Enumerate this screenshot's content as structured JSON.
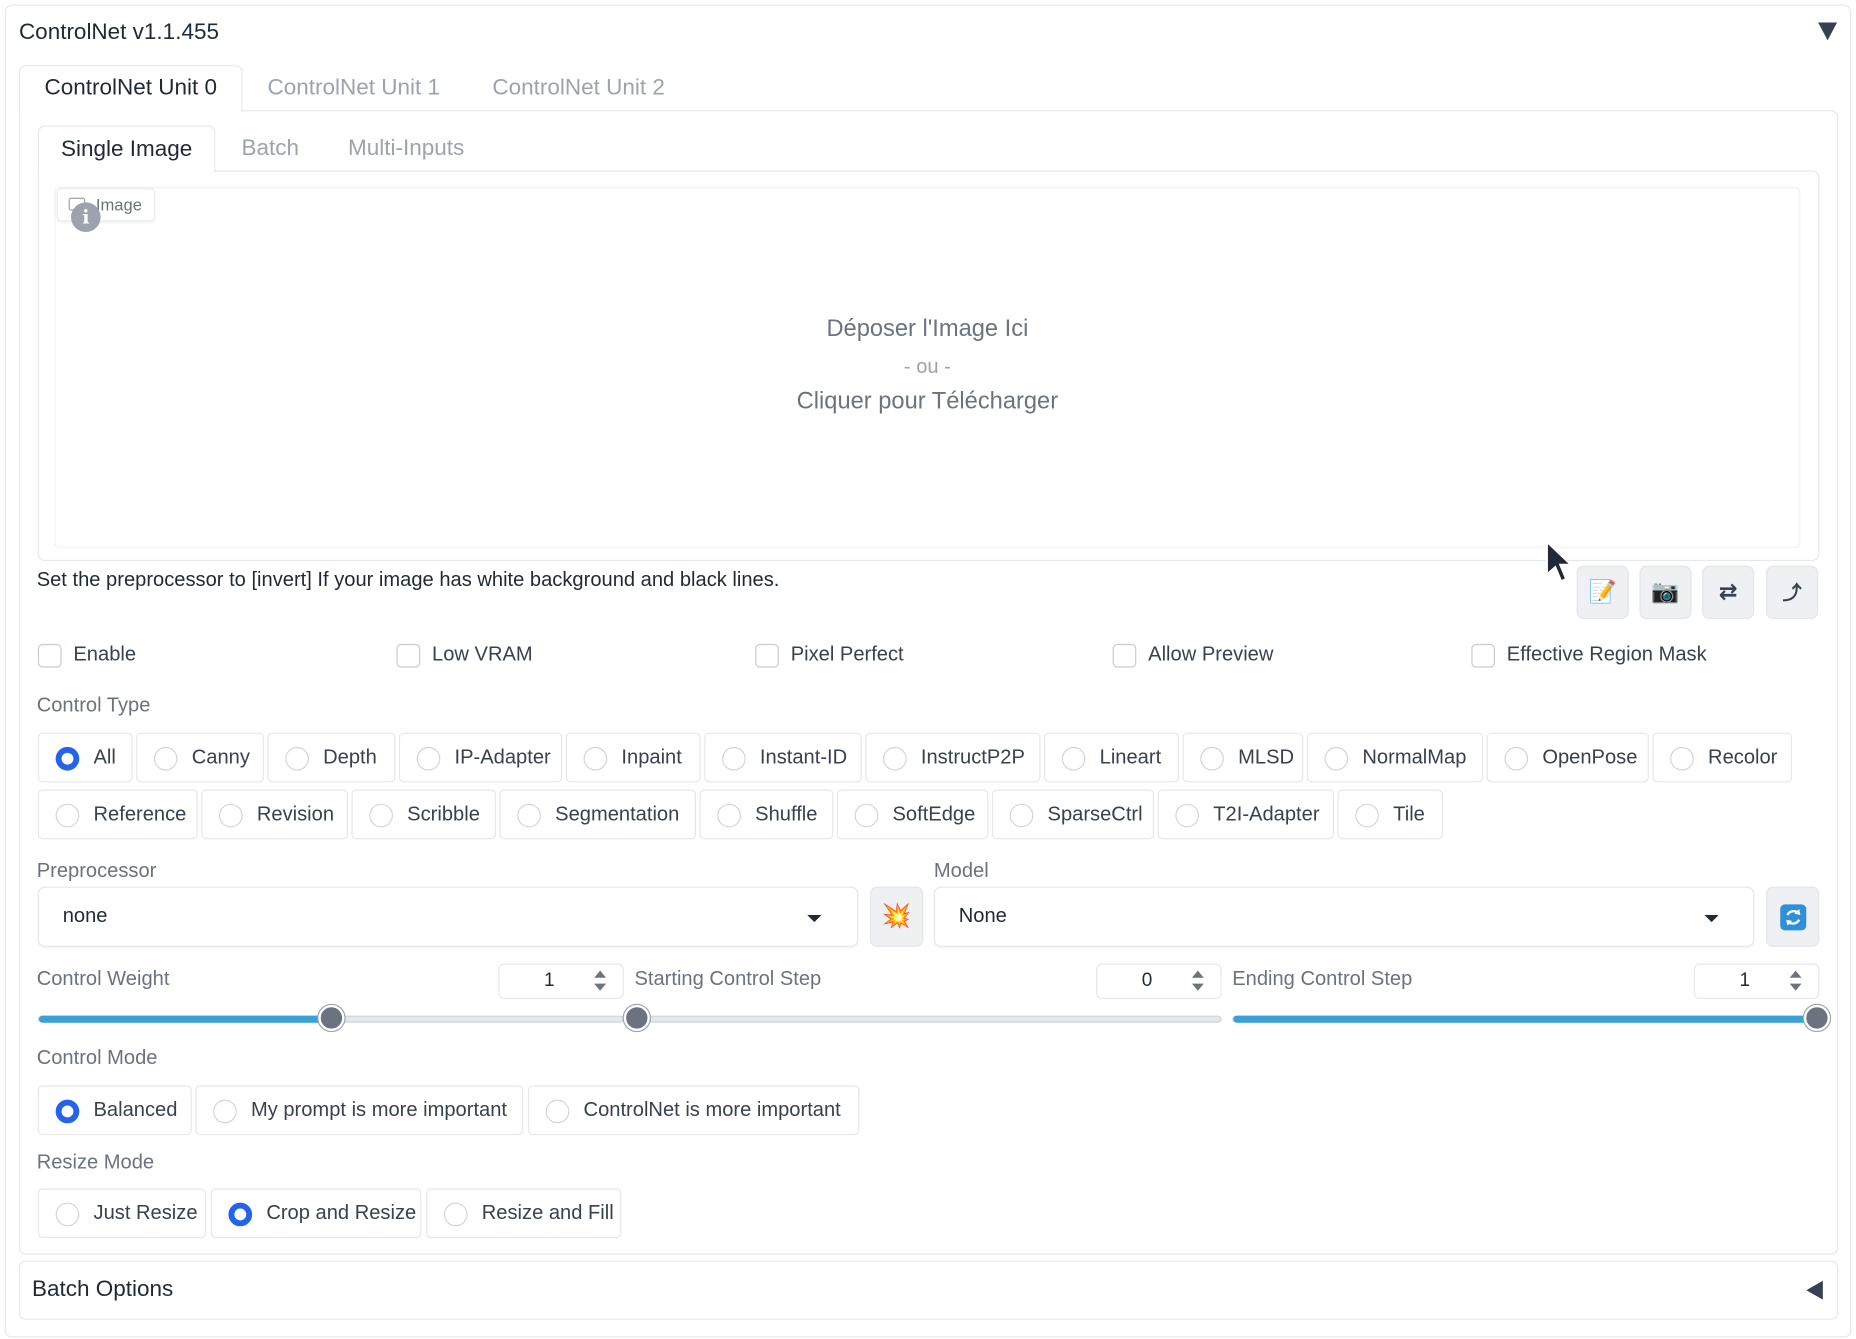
{
  "header": {
    "title": "ControlNet v1.1.455"
  },
  "unit_tabs": [
    "ControlNet Unit 0",
    "ControlNet Unit 1",
    "ControlNet Unit 2"
  ],
  "image_tabs": [
    "Single Image",
    "Batch",
    "Multi-Inputs"
  ],
  "upload": {
    "chip_label": "Image",
    "drop_text": "Déposer l'Image Ici",
    "or_text": "- ou -",
    "click_text": "Cliquer pour Télécharger"
  },
  "hint": "Set the preprocessor to [invert] If your image has white background and black lines.",
  "toolbar": {
    "icons": [
      "pencil-icon",
      "camera-icon",
      "swap-icon",
      "send-icon"
    ]
  },
  "checkboxes": [
    {
      "label": "Enable",
      "checked": false
    },
    {
      "label": "Low VRAM",
      "checked": false
    },
    {
      "label": "Pixel Perfect",
      "checked": false
    },
    {
      "label": "Allow Preview",
      "checked": false
    },
    {
      "label": "Effective Region Mask",
      "checked": false
    }
  ],
  "control_type": {
    "label": "Control Type",
    "selected": "All",
    "options": [
      "All",
      "Canny",
      "Depth",
      "IP-Adapter",
      "Inpaint",
      "Instant-ID",
      "InstructP2P",
      "Lineart",
      "MLSD",
      "NormalMap",
      "OpenPose",
      "Recolor",
      "Reference",
      "Revision",
      "Scribble",
      "Segmentation",
      "Shuffle",
      "SoftEdge",
      "SparseCtrl",
      "T2I-Adapter",
      "Tile"
    ]
  },
  "preprocessor": {
    "label": "Preprocessor",
    "value": "none"
  },
  "model": {
    "label": "Model",
    "value": "None"
  },
  "sliders": [
    {
      "label": "Control Weight",
      "value": "1",
      "fraction": 0.5
    },
    {
      "label": "Starting Control Step",
      "value": "0",
      "fraction": 0.0
    },
    {
      "label": "Ending Control Step",
      "value": "1",
      "fraction": 1.0
    }
  ],
  "control_mode": {
    "label": "Control Mode",
    "selected": "Balanced",
    "options": [
      "Balanced",
      "My prompt is more important",
      "ControlNet is more important"
    ]
  },
  "resize_mode": {
    "label": "Resize Mode",
    "selected": "Crop and Resize",
    "options": [
      "Just Resize",
      "Crop and Resize",
      "Resize and Fill"
    ]
  },
  "batch_options": {
    "label": "Batch Options"
  },
  "colors": {
    "accent": "#2563eb",
    "slider_fill": "#3aa0d8",
    "panel_border": "#e5e7eb"
  }
}
